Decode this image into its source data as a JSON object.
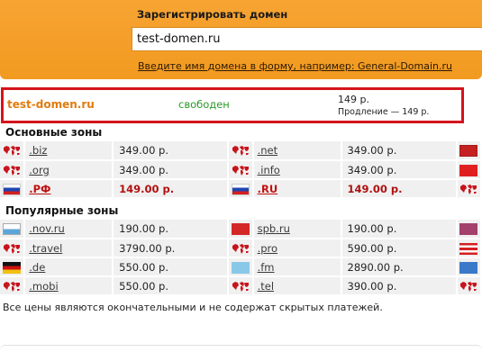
{
  "header": {
    "title": "Зарегистрировать домен",
    "input_value": "test-domen.ru",
    "hint": "Введите имя домена в форму, например: General-Domain.ru"
  },
  "result": {
    "domain": "test-domen.ru",
    "status": "свободен",
    "price": "149 р.",
    "renewal": "Продление — 149 р."
  },
  "sections": {
    "main_title": "Основные зоны",
    "popular_title": "Популярные зоны"
  },
  "main_zones": [
    [
      {
        "icon": "world-map-icon",
        "flag": "map",
        "zone": ".biz",
        "price": "349.00 р.",
        "bold": false
      },
      {
        "icon": "world-map-icon",
        "flag": "map",
        "zone": ".net",
        "price": "349.00 р.",
        "bold": false
      },
      {
        "icon": "flag-me-icon",
        "flag": "me"
      }
    ],
    [
      {
        "icon": "world-map-icon",
        "flag": "map",
        "zone": ".org",
        "price": "349.00 р.",
        "bold": false
      },
      {
        "icon": "world-map-icon",
        "flag": "map",
        "zone": ".info",
        "price": "349.00 р.",
        "bold": false
      },
      {
        "icon": "flag-cn-icon",
        "flag": "cn"
      }
    ],
    [
      {
        "icon": "flag-ru-icon",
        "flag": "ru",
        "zone": ".РФ",
        "price": "149.00 р.",
        "bold": true
      },
      {
        "icon": "flag-ru-icon",
        "flag": "ru",
        "zone": ".RU",
        "price": "149.00 р.",
        "bold": true
      },
      {
        "icon": "world-map-icon",
        "flag": "map"
      }
    ]
  ],
  "popular_zones": [
    [
      {
        "icon": "flag-sm-icon",
        "flag": "sm",
        "zone": ".nov.ru",
        "price": "190.00 р.",
        "bold": false
      },
      {
        "icon": "flag-spb-icon",
        "flag": "spb",
        "zone": "spb.ru",
        "price": "190.00 р.",
        "bold": false
      },
      {
        "icon": "flag-mm-icon",
        "flag": "mm"
      }
    ],
    [
      {
        "icon": "world-map-icon",
        "flag": "map",
        "zone": ".travel",
        "price": "3790.00 р.",
        "bold": false
      },
      {
        "icon": "world-map-icon",
        "flag": "map",
        "zone": ".pro",
        "price": "590.00 р.",
        "bold": false
      },
      {
        "icon": "flag-pr-icon",
        "flag": "pr"
      }
    ],
    [
      {
        "icon": "flag-de-icon",
        "flag": "de",
        "zone": ".de",
        "price": "550.00 р.",
        "bold": false
      },
      {
        "icon": "flag-fm-icon",
        "flag": "fm",
        "zone": ".fm",
        "price": "2890.00 р.",
        "bold": false
      },
      {
        "icon": "flag-tv-icon",
        "flag": "tv"
      }
    ],
    [
      {
        "icon": "world-map-icon",
        "flag": "map",
        "zone": ".mobi",
        "price": "550.00 р.",
        "bold": false
      },
      {
        "icon": "world-map-icon",
        "flag": "map",
        "zone": ".tel",
        "price": "390.00 р.",
        "bold": false
      },
      {
        "icon": "world-map-icon",
        "flag": "map"
      }
    ]
  ],
  "footnote": "Все цены являются окончательными и не содержат скрытых платежей.",
  "colors": {
    "header_orange": "#f29a20",
    "highlight_red": "#d4141c",
    "status_green": "#2a9a2a",
    "domain_orange": "#e07b10"
  }
}
